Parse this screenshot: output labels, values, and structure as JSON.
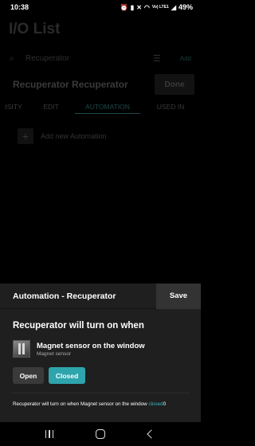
{
  "status_bar": {
    "time": "10:38",
    "icons": [
      "alarm-icon",
      "vibrate-icon",
      "mute-icon",
      "wifi-icon",
      "volte-icon",
      "signal-icon"
    ],
    "volte": "Vo) LTE1",
    "battery": "49%"
  },
  "app": {
    "title": "I/O List",
    "search_value": "Recuperator",
    "add_label": "Add"
  },
  "detail": {
    "name": "Recuperator Recuperator",
    "done_label": "Done",
    "tabs": [
      "ISITY",
      "EDIT",
      "AUTOMATION",
      "USED IN"
    ],
    "active_tab": "AUTOMATION",
    "add_automation_label": "Add new Automation"
  },
  "sheet": {
    "title": "Automation - Recuperator",
    "save_label": "Save",
    "condition_heading": "Recuperator will turn on when",
    "sensor_name": "Magnet sensor on the window",
    "sensor_type": "Magnet sensor",
    "open_label": "Open",
    "closed_label": "Closed",
    "selected_state": "Closed",
    "summary_text": "Recuperator will turn on when Magnet sensor on the window ",
    "summary_state": "closed",
    "summary_suffix": "0",
    "accent_color": "#2ea5ac"
  },
  "nav": {
    "recent_icon": "recent-apps-icon",
    "home_icon": "home-icon",
    "back_icon": "back-icon"
  }
}
